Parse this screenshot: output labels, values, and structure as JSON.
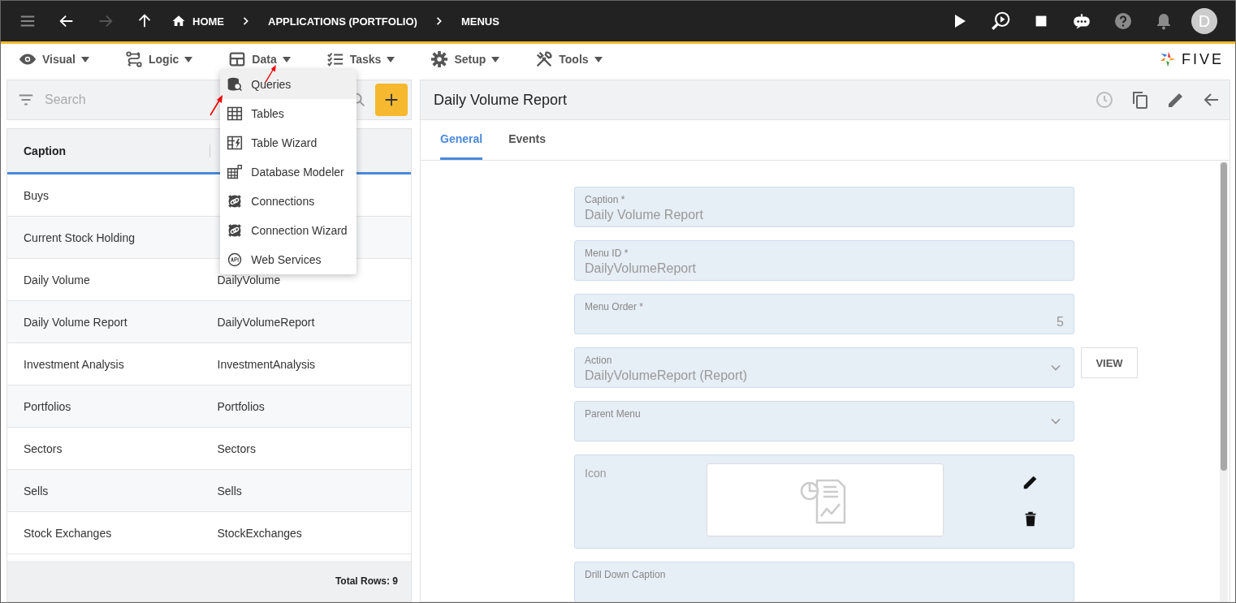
{
  "top_bar": {
    "nav": [
      {
        "kind": "back",
        "disabled": false
      },
      {
        "kind": "forward",
        "disabled": true
      },
      {
        "kind": "up",
        "disabled": false
      }
    ],
    "breadcrumbs": [
      {
        "label": "HOME",
        "kind": "home"
      },
      {
        "label": "APPLICATIONS (PORTFOLIO)",
        "kind": "plain"
      },
      {
        "label": "MENUS",
        "kind": "plain"
      }
    ],
    "actions": [
      {
        "kind": "run"
      },
      {
        "kind": "inspect"
      },
      {
        "kind": "stop"
      },
      {
        "kind": "assistant"
      },
      {
        "kind": "help"
      },
      {
        "kind": "bell"
      }
    ],
    "avatar": "D"
  },
  "toolbar": {
    "menus": [
      {
        "label": "Visual",
        "kind": "eye",
        "expanded": false
      },
      {
        "label": "Logic",
        "kind": "logic",
        "expanded": false
      },
      {
        "label": "Data",
        "kind": "grid",
        "expanded": true
      },
      {
        "label": "Tasks",
        "kind": "tasks",
        "expanded": false
      },
      {
        "label": "Setup",
        "kind": "gear",
        "expanded": false
      },
      {
        "label": "Tools",
        "kind": "tools",
        "expanded": false
      }
    ],
    "logo": "FIVE"
  },
  "data_menu": [
    {
      "label": "Queries",
      "kind": "database",
      "selected": true
    },
    {
      "label": "Tables",
      "kind": "table",
      "selected": false
    },
    {
      "label": "Table Wizard",
      "kind": "table-wizard",
      "selected": false
    },
    {
      "label": "Database Modeler",
      "kind": "modeler",
      "selected": false
    },
    {
      "label": "Connections",
      "kind": "connection",
      "selected": false
    },
    {
      "label": "Connection Wizard",
      "kind": "connection",
      "selected": false
    },
    {
      "label": "Web Services",
      "kind": "api",
      "selected": false
    }
  ],
  "list": {
    "search": {
      "placeholder": "Search"
    },
    "columns": [
      "Caption"
    ],
    "rows": [
      {
        "caption": "Buys"
      },
      {
        "caption": "Current Stock Holding"
      },
      {
        "caption": "Daily Volume",
        "menu_id": "DailyVolume"
      },
      {
        "caption": "Daily Volume Report",
        "menu_id": "DailyVolumeReport"
      },
      {
        "caption": "Investment Analysis",
        "menu_id": "InvestmentAnalysis"
      },
      {
        "caption": "Portfolios",
        "menu_id": "Portfolios"
      },
      {
        "caption": "Sectors",
        "menu_id": "Sectors"
      },
      {
        "caption": "Sells",
        "menu_id": "Sells"
      },
      {
        "caption": "Stock Exchanges",
        "menu_id": "StockExchanges"
      }
    ],
    "total": "Total Rows: 9"
  },
  "form": {
    "title": "Daily Volume Report",
    "tabs": [
      {
        "label": "General",
        "selected": true
      },
      {
        "label": "Events",
        "selected": false
      }
    ],
    "fields": [
      {
        "label": "Caption *",
        "value": "Daily Volume Report",
        "kind": "text"
      },
      {
        "label": "Menu ID *",
        "value": "DailyVolumeReport",
        "kind": "text"
      },
      {
        "label": "Menu Order *",
        "value": "5",
        "kind": "number"
      },
      {
        "label": "Action",
        "value": "DailyVolumeReport (Report)",
        "kind": "select",
        "button": "VIEW"
      },
      {
        "label": "Parent Menu",
        "kind": "select"
      },
      {
        "label": "Icon",
        "kind": "icon"
      },
      {
        "label": "Drill Down Caption",
        "kind": "text"
      }
    ]
  }
}
